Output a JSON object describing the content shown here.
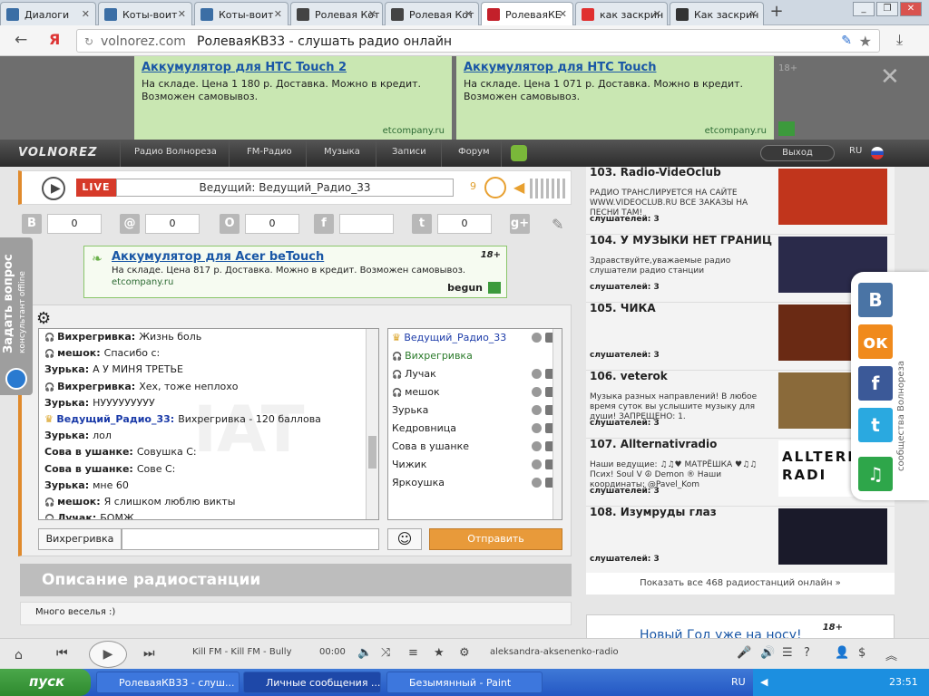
{
  "browser": {
    "tabs": [
      {
        "label": "Диалоги",
        "icon": "vk-mail-icon",
        "color": "#3b6ea5"
      },
      {
        "label": "Коты-воит",
        "icon": "vk-icon",
        "color": "#3b6ea5"
      },
      {
        "label": "Коты-воит",
        "icon": "vk-icon",
        "color": "#3b6ea5"
      },
      {
        "label": "Ролевая Кот",
        "icon": "feather-icon",
        "color": "#444"
      },
      {
        "label": "Ролевая Кот",
        "icon": "feather-icon",
        "color": "#444"
      },
      {
        "label": "РолеваяКЕ",
        "icon": "volnorez-icon",
        "color": "#c3202a"
      },
      {
        "label": "как заскрин",
        "icon": "yandex-icon",
        "color": "#e03030"
      },
      {
        "label": "Как заскрин",
        "icon": "monitor-icon",
        "color": "#333"
      }
    ],
    "new_tab": "+",
    "back": "←",
    "yandex_logo": "Я",
    "url_domain": "volnorez.com",
    "url_title": "РолеваяКВ33 - слушать радио онлайн",
    "min": "_",
    "max": "❐",
    "close": "✕"
  },
  "top_ads": [
    {
      "title": "Аккумулятор для HTC Touch 2",
      "body": "На складе. Цена 1 180 р. Доставка. Можно в кредит. Возможен самовывоз.",
      "source": "etcompany.ru"
    },
    {
      "title": "Аккумулятор для HTC Touch",
      "body": "На складе. Цена 1 071 р. Доставка. Можно в кредит. Возможен самовывоз.",
      "source": "etcompany.ru"
    }
  ],
  "ad_age": "18+",
  "nav": {
    "logo": "VOLNOREZ",
    "items": [
      "Радио Волнореза",
      "FM-Радио",
      "Музыка",
      "Записи",
      "Форум"
    ],
    "logout": "Выход",
    "lang": "RU"
  },
  "player": {
    "live": "LIVE",
    "host": "Ведущий: Ведущий_Радио_33",
    "listeners": "9"
  },
  "social": [
    {
      "icon": "vk-icon",
      "glyph": "В",
      "count": "0"
    },
    {
      "icon": "mail-icon",
      "glyph": "@",
      "count": "0"
    },
    {
      "icon": "odnoklassniki-icon",
      "glyph": "О",
      "count": "0"
    },
    {
      "icon": "facebook-icon",
      "glyph": "f",
      "count": ""
    },
    {
      "icon": "twitter-icon",
      "glyph": "t",
      "count": "0"
    },
    {
      "icon": "google-plus-icon",
      "glyph": "g+",
      "count": ""
    }
  ],
  "mid_ad": {
    "title": "Аккумулятор для Acer beTouch",
    "body": "На складе. Цена 817 р. Доставка. Можно в кредит. Возможен самовывоз.",
    "source": "etcompany.ru",
    "age": "18+",
    "brand": "begun"
  },
  "chat": {
    "watermark": "IAT",
    "messages": [
      {
        "nick": "Вихрегривка:",
        "text": "Жизнь боль",
        "hp": true,
        "crown": false
      },
      {
        "nick": "мешок:",
        "text": "Спасибо с:",
        "hp": true,
        "crown": false
      },
      {
        "nick": "Зурька:",
        "text": "А У МИНЯ ТРЕТЬЕ",
        "hp": false,
        "crown": false
      },
      {
        "nick": "Вихрегривка:",
        "text": "Хех, тоже неплохо",
        "hp": true,
        "crown": false
      },
      {
        "nick": "Зурька:",
        "text": "НУУУУУУУУУ",
        "hp": false,
        "crown": false
      },
      {
        "nick": "Ведущий_Радио_33:",
        "text": "Вихрегривка - 120 баллова",
        "hp": false,
        "crown": true
      },
      {
        "nick": "Зурька:",
        "text": "лол",
        "hp": false,
        "crown": false
      },
      {
        "nick": "Сова в ушанке:",
        "text": "Совушка С:",
        "hp": false,
        "crown": false
      },
      {
        "nick": "Сова в ушанке:",
        "text": "Сове С:",
        "hp": false,
        "crown": false
      },
      {
        "nick": "Зурька:",
        "text": "мне 60",
        "hp": false,
        "crown": false
      },
      {
        "nick": "мешок:",
        "text": "Я слишком люблю викты",
        "hp": true,
        "crown": false
      },
      {
        "nick": "Лучак:",
        "text": "БОМЖ",
        "hp": true,
        "crown": false
      }
    ],
    "users": [
      {
        "name": "Ведущий_Радио_33",
        "crown": true,
        "hp": false,
        "icons": true
      },
      {
        "name": "Вихрегривка",
        "crown": false,
        "hp": true,
        "icons": false
      },
      {
        "name": "Лучак",
        "crown": false,
        "hp": true,
        "icons": true
      },
      {
        "name": "мешок",
        "crown": false,
        "hp": true,
        "icons": true
      },
      {
        "name": "Зурька",
        "crown": false,
        "hp": false,
        "icons": true
      },
      {
        "name": "Кедровница",
        "crown": false,
        "hp": false,
        "icons": true
      },
      {
        "name": "Сова в ушанке",
        "crown": false,
        "hp": false,
        "icons": true
      },
      {
        "name": "Чижик",
        "crown": false,
        "hp": false,
        "icons": true
      },
      {
        "name": "Яркоушка",
        "crown": false,
        "hp": false,
        "icons": true
      }
    ],
    "nick": "Вихрегривка",
    "input_value": "",
    "send": "Отправить"
  },
  "description": {
    "title": "Описание радиостанции",
    "body": "Много веселья :)"
  },
  "stations": [
    {
      "title": "103. Radio-VideOclub",
      "desc": "РАДИО ТРАНСЛИРУЕТСЯ НА САЙТЕ WWW.VIDEOCLUB.RU ВСЕ ЗАКАЗЫ НА ПЕСНИ ТАМ!",
      "listeners": "слушателей: 3",
      "img_color": "#c1351c",
      "img_label": ""
    },
    {
      "title": "104. У МУЗЫКИ НЕТ ГРАНИЦ",
      "desc": "Здравствуйте,уважаемые радио слушатели радио станции",
      "listeners": "слушателей: 3",
      "img_color": "#2a2a4a",
      "img_label": ""
    },
    {
      "title": "105. ЧИКА",
      "desc": "",
      "listeners": "слушателей: 3",
      "img_color": "#6a2a14",
      "img_label": ""
    },
    {
      "title": "106. veterok",
      "desc": "Музыка разных направлений! В любое время суток вы услышите музыку для души! ЗАПРЕЩЕНО: 1.",
      "listeners": "слушателей: 3",
      "img_color": "#8a6a3a",
      "img_label": ""
    },
    {
      "title": "107. Allternativradio",
      "desc": "Наши ведущие: ♫♫♥ МАТРЁШКА ♥♫♫ Псих! Soul V ☮ Demon ® Наши координаты: @Pavel_Kom",
      "listeners": "слушателей: 3",
      "img_color": "#ffffff",
      "img_label": "ALLTERN RADI"
    },
    {
      "title": "108. Изумруды глаз",
      "desc": "",
      "listeners": "слушателей: 3",
      "img_color": "#1a1a2a",
      "img_label": ""
    }
  ],
  "show_all": "Показать все 468 радиостанций онлайн »",
  "bottom_ad": {
    "title": "Новый Год уже на носу!",
    "age": "18+"
  },
  "side_panel": {
    "label": "сообщества Волнореза",
    "buttons": [
      {
        "icon": "vk-icon",
        "glyph": "В",
        "color": "#4a74a5"
      },
      {
        "icon": "odnoklassniki-icon",
        "glyph": "ок",
        "color": "#f08a1c"
      },
      {
        "icon": "facebook-icon",
        "glyph": "f",
        "color": "#3b5998"
      },
      {
        "icon": "twitter-icon",
        "glyph": "t",
        "color": "#2aa9e0"
      },
      {
        "icon": "music-icon",
        "glyph": "♫",
        "color": "#2ea64a"
      }
    ]
  },
  "feedback": {
    "title": "Задать вопрос",
    "subtitle": "консультант offline"
  },
  "mini_player": {
    "track": "Kill FM - Kill FM - Bully",
    "time": "00:00",
    "station": "aleksandra-aksenenko-radio"
  },
  "taskbar": {
    "start": "пуск",
    "items": [
      "РолеваяКВ33 - слуш...",
      "Личные сообщения ...",
      "Безымянный - Paint"
    ],
    "lang": "RU",
    "clock": "23:51"
  }
}
